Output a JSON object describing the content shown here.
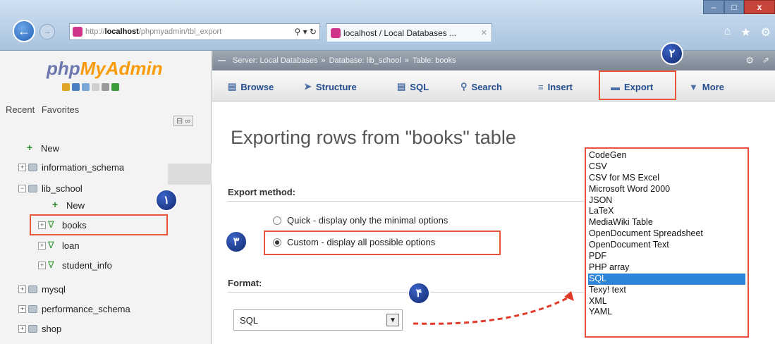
{
  "browser": {
    "url_scheme": "http://",
    "url_host": "localhost",
    "url_path": "/phpmyadmin/tbl_export",
    "tab_title": "localhost / Local Databases ...",
    "close_glyph": "✕"
  },
  "sidebar": {
    "logo_php": "php",
    "logo_myadmin": "MyAdmin",
    "recent": "Recent",
    "favorites": "Favorites",
    "tree": [
      {
        "label": "New"
      },
      {
        "label": "information_schema"
      },
      {
        "label": "lib_school"
      },
      {
        "label": "New"
      },
      {
        "label": "books"
      },
      {
        "label": "loan"
      },
      {
        "label": "student_info"
      },
      {
        "label": "mysql"
      },
      {
        "label": "performance_schema"
      },
      {
        "label": "shop"
      }
    ]
  },
  "breadcrumb": {
    "server": "Server: Local Databases",
    "database": "Database: lib_school",
    "table": "Table: books"
  },
  "menu": {
    "browse": "Browse",
    "structure": "Structure",
    "sql": "SQL",
    "search": "Search",
    "insert": "Insert",
    "export": "Export",
    "more": "More"
  },
  "main": {
    "title": "Exporting rows from \"books\" table",
    "export_method_label": "Export method:",
    "quick_option": "Quick - display only the minimal options",
    "custom_option": "Custom - display all possible options",
    "format_label": "Format:",
    "format_value": "SQL"
  },
  "format_options": [
    "CodeGen",
    "CSV",
    "CSV for MS Excel",
    "Microsoft Word 2000",
    "JSON",
    "LaTeX",
    "MediaWiki Table",
    "OpenDocument Spreadsheet",
    "OpenDocument Text",
    "PDF",
    "PHP array",
    "SQL",
    "Texy! text",
    "XML",
    "YAML"
  ],
  "selected_format": "SQL",
  "badges": {
    "b1": "١",
    "b2": "٢",
    "b3": "٣",
    "b4": "۴"
  },
  "colors": {
    "highlight": "#e7553a",
    "badge": "#1c3a8f",
    "selection": "#2c85d8"
  }
}
